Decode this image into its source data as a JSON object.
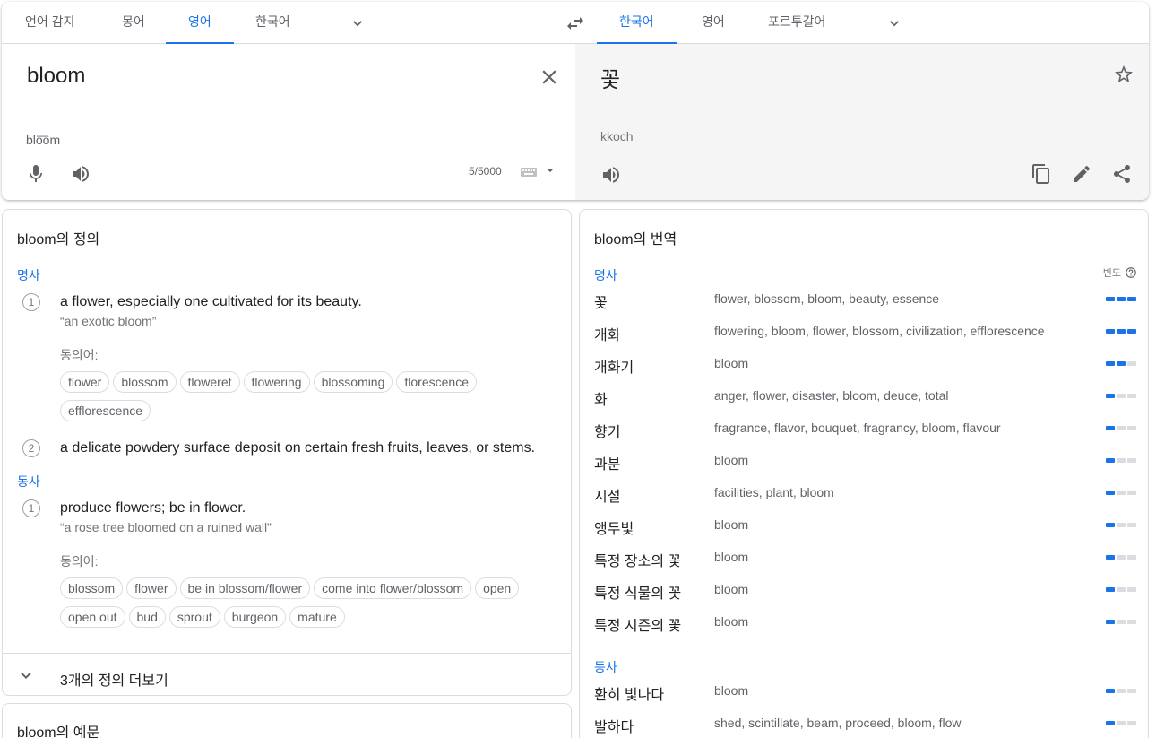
{
  "source_tabs": [
    "언어 감지",
    "몽어",
    "영어",
    "한국어"
  ],
  "target_tabs": [
    "한국어",
    "영어",
    "포르투갈어"
  ],
  "source": {
    "text": "bloom",
    "phonetic": "blo͞om",
    "counter": "5/5000"
  },
  "target": {
    "text": "꽃",
    "phonetic": "kkoch"
  },
  "definitions": {
    "title": "bloom의 정의",
    "noun_label": "명사",
    "verb_label": "동사",
    "syn_label": "동의어:",
    "noun1": {
      "num": "1",
      "gloss": "a flower, especially one cultivated for its beauty.",
      "example": "“an exotic bloom”",
      "synonyms": [
        "flower",
        "blossom",
        "floweret",
        "flowering",
        "blossoming",
        "florescence",
        "efflorescence"
      ]
    },
    "noun2": {
      "num": "2",
      "gloss": "a delicate powdery surface deposit on certain fresh fruits, leaves, or stems."
    },
    "verb1": {
      "num": "1",
      "gloss": "produce flowers; be in flower.",
      "example": "“a rose tree bloomed on a ruined wall”",
      "synonyms": [
        "blossom",
        "flower",
        "be in blossom/flower",
        "come into flower/blossom",
        "open",
        "open out",
        "bud",
        "sprout",
        "burgeon",
        "mature"
      ]
    },
    "more": "3개의 정의 더보기"
  },
  "translations": {
    "title": "bloom의 번역",
    "noun_label": "명사",
    "verb_label": "동사",
    "freq_label": "빈도",
    "nouns": [
      {
        "word": "꽃",
        "syn": "flower, blossom, bloom, beauty, essence",
        "freq": 3
      },
      {
        "word": "개화",
        "syn": "flowering, bloom, flower, blossom, civilization, efflorescence",
        "freq": 3
      },
      {
        "word": "개화기",
        "syn": "bloom",
        "freq": 2
      },
      {
        "word": "화",
        "syn": "anger, flower, disaster, bloom, deuce, total",
        "freq": 1
      },
      {
        "word": "향기",
        "syn": "fragrance, flavor, bouquet, fragrancy, bloom, flavour",
        "freq": 1
      },
      {
        "word": "과분",
        "syn": "bloom",
        "freq": 1
      },
      {
        "word": "시설",
        "syn": "facilities, plant, bloom",
        "freq": 1
      },
      {
        "word": "앵두빛",
        "syn": "bloom",
        "freq": 1
      },
      {
        "word": "특정 장소의 꽃",
        "syn": "bloom",
        "freq": 1
      },
      {
        "word": "특정 식물의 꽃",
        "syn": "bloom",
        "freq": 1
      },
      {
        "word": "특정 시즌의 꽃",
        "syn": "bloom",
        "freq": 1
      }
    ],
    "verbs": [
      {
        "word": "환히 빛나다",
        "syn": "bloom",
        "freq": 1
      },
      {
        "word": "발하다",
        "syn": "shed, scintillate, beam, proceed, bloom, flow",
        "freq": 1
      }
    ]
  },
  "examples": {
    "title": "bloom의 예문"
  },
  "colors": {
    "accent": "#1a73e8",
    "target_bg": "#f5f5f5"
  }
}
